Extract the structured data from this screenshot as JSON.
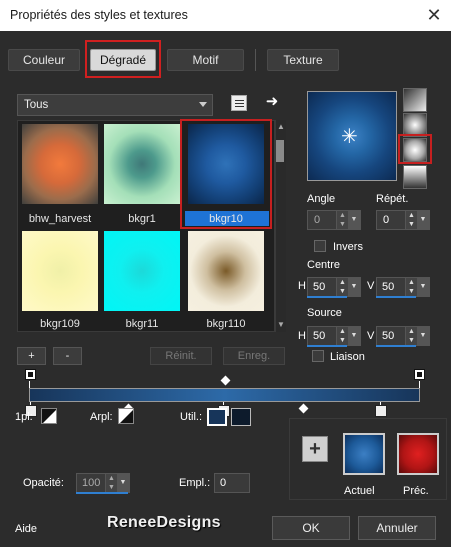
{
  "window": {
    "title": "Propriétés des styles et textures",
    "close_glyph": "✕"
  },
  "tabs": [
    {
      "label": "Couleur"
    },
    {
      "label": "Dégradé",
      "active": true
    },
    {
      "label": "Motif"
    },
    {
      "label": "Texture"
    }
  ],
  "gallery": {
    "category": "Tous",
    "items": [
      {
        "label": "bhw_harvest"
      },
      {
        "label": "bkgr1"
      },
      {
        "label": "bkgr10",
        "selected": true
      },
      {
        "label": "bkgr109"
      },
      {
        "label": "bkgr11"
      },
      {
        "label": "bkgr110"
      }
    ],
    "add_label": "+",
    "remove_label": "-",
    "reset_label": "Réinit.",
    "save_label": "Enreg."
  },
  "settings": {
    "angle_label": "Angle",
    "angle_value": "0",
    "repeat_label": "Répét.",
    "repeat_value": "0",
    "invert_label": "Invers",
    "center_label": "Centre",
    "center_h_label": "H",
    "center_h": "50",
    "center_v_label": "V",
    "center_v": "50",
    "source_label": "Source",
    "source_h_label": "H",
    "source_h": "50",
    "source_v_label": "V",
    "source_v": "50",
    "link_label": "Liaison"
  },
  "stops": {
    "one_pl_label": "1pl:",
    "arpl_label": "Arpl:",
    "util_label": "Util.:",
    "opacity_label": "Opacité:",
    "opacity_value": "100",
    "empl_label": "Empl.:",
    "empl_value": "0"
  },
  "swatches": {
    "current_label": "Actuel",
    "previous_label": "Préc.",
    "current_color": "#2a6bb0",
    "previous_color": "#c81818"
  },
  "footer": {
    "help_label": "Aide",
    "brand": "ReneeDesigns",
    "ok_label": "OK",
    "cancel_label": "Annuler"
  }
}
